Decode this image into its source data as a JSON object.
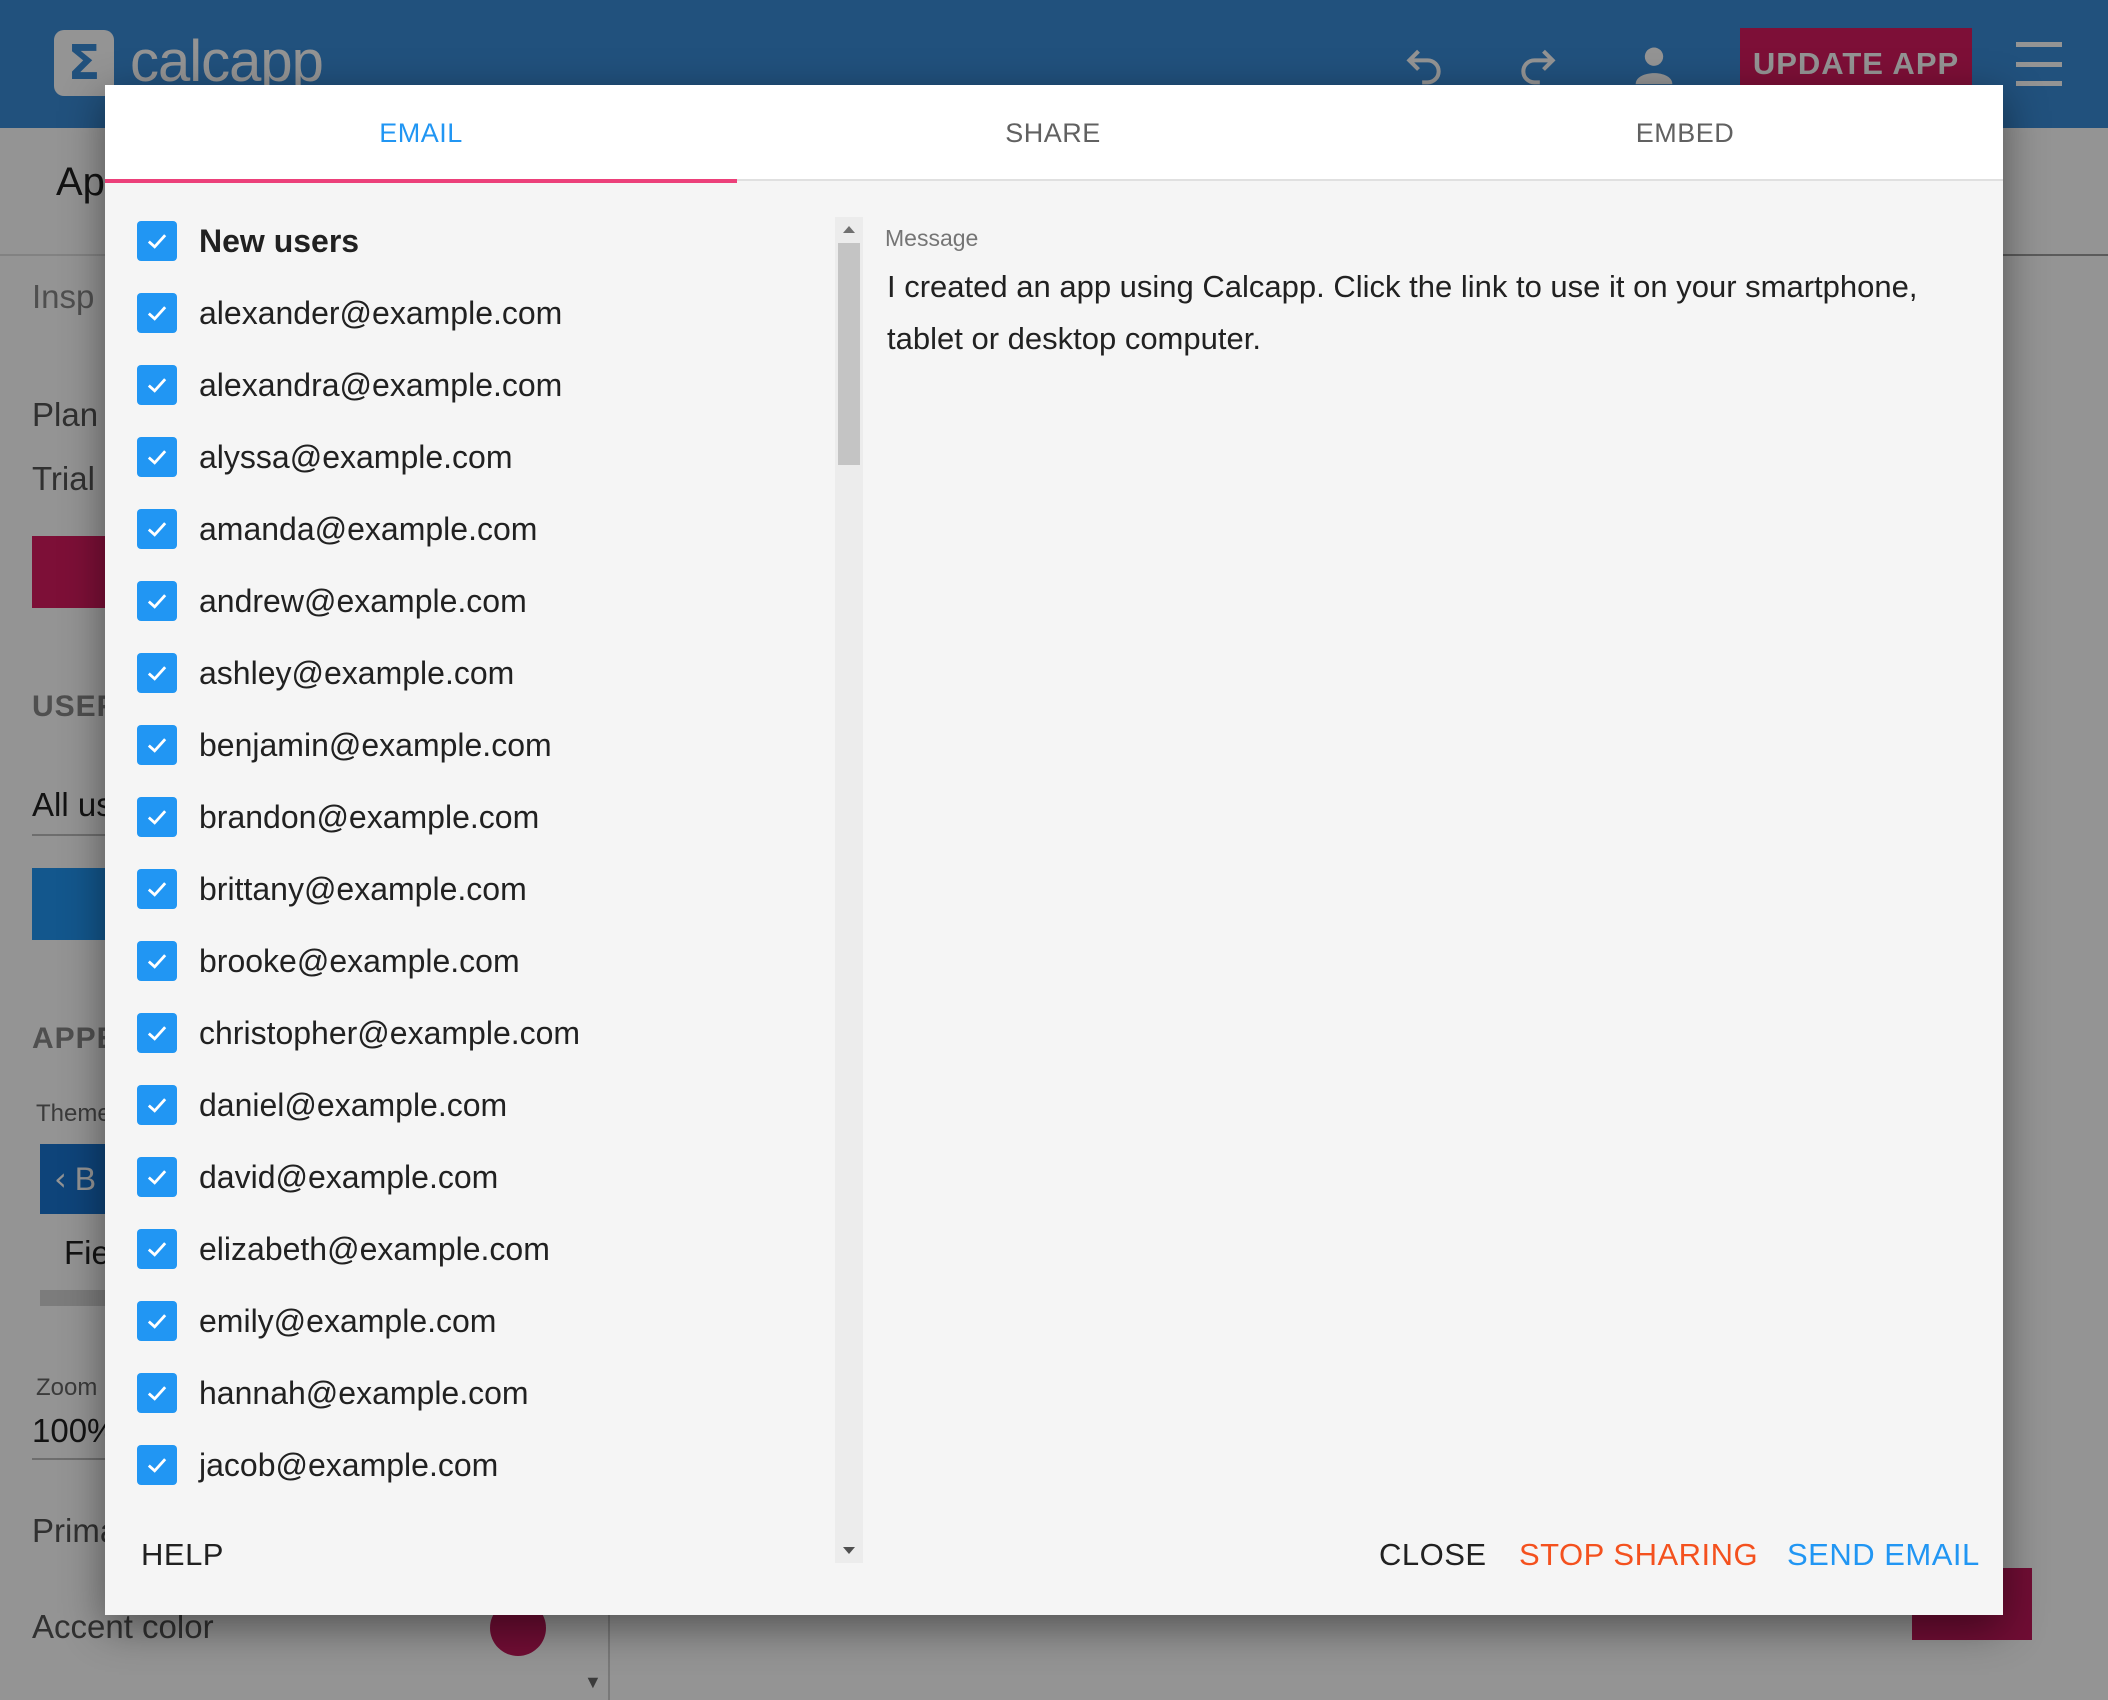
{
  "app": {
    "logo_symbol": "Σ",
    "name": "calcapp",
    "update_button": "UPDATE APP",
    "icons": [
      "undo-icon",
      "redo-icon",
      "account-icon",
      "menu-icon"
    ],
    "brand_color": "#3a8cd8",
    "accent_color": "#d81b60"
  },
  "background": {
    "page_title": "Ap",
    "inspector_label": "Insp",
    "plan_label": "Plan",
    "trial_label": "Trial e",
    "users_section": "USER",
    "all_users_value": "All us",
    "appearance_section": "APPE",
    "theme_label": "Theme",
    "theme_card_label": "B",
    "field_label": "Fie",
    "zoom_label": "Zoom",
    "zoom_value": "100%",
    "primary_label": "Prima",
    "accent_label": "Accent color"
  },
  "dialog": {
    "tabs": [
      {
        "label": "EMAIL",
        "active": true
      },
      {
        "label": "SHARE",
        "active": false
      },
      {
        "label": "EMBED",
        "active": false
      }
    ],
    "users": [
      {
        "label": "New users",
        "checked": true,
        "bold": true
      },
      {
        "label": "alexander@example.com",
        "checked": true
      },
      {
        "label": "alexandra@example.com",
        "checked": true
      },
      {
        "label": "alyssa@example.com",
        "checked": true
      },
      {
        "label": "amanda@example.com",
        "checked": true
      },
      {
        "label": "andrew@example.com",
        "checked": true
      },
      {
        "label": "ashley@example.com",
        "checked": true
      },
      {
        "label": "benjamin@example.com",
        "checked": true
      },
      {
        "label": "brandon@example.com",
        "checked": true
      },
      {
        "label": "brittany@example.com",
        "checked": true
      },
      {
        "label": "brooke@example.com",
        "checked": true
      },
      {
        "label": "christopher@example.com",
        "checked": true
      },
      {
        "label": "daniel@example.com",
        "checked": true
      },
      {
        "label": "david@example.com",
        "checked": true
      },
      {
        "label": "elizabeth@example.com",
        "checked": true
      },
      {
        "label": "emily@example.com",
        "checked": true
      },
      {
        "label": "hannah@example.com",
        "checked": true
      },
      {
        "label": "jacob@example.com",
        "checked": true
      }
    ],
    "message_label": "Message",
    "message_text": "I created an app using Calcapp. Click the link to use it on your smartphone, tablet or desktop computer.",
    "buttons": {
      "help": "HELP",
      "close": "CLOSE",
      "stop_sharing": "STOP SHARING",
      "send_email": "SEND EMAIL"
    },
    "colors": {
      "active_tab": "#2196f3",
      "tab_indicator": "#ec407a",
      "checkbox": "#2196f3",
      "stop_sharing": "#f4511e",
      "send_email": "#2196f3"
    }
  }
}
